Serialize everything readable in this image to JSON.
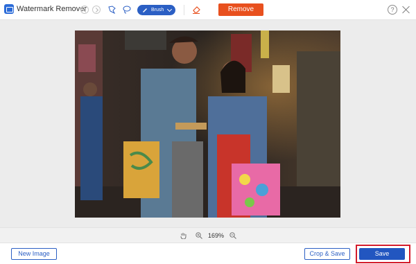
{
  "app": {
    "title": "Watermark Remover"
  },
  "toolbar": {
    "icons": [
      "undo-icon",
      "redo-icon",
      "polygon-lasso-icon",
      "lasso-icon",
      "brush-icon",
      "eraser-icon"
    ],
    "brush_label": "Brush",
    "remove_label": "Remove",
    "help_label": "?"
  },
  "zoom": {
    "level": "169%"
  },
  "footer": {
    "new_image_label": "New Image",
    "crop_save_label": "Crop & Save",
    "save_label": "Save"
  },
  "colors": {
    "accent": "#2b5fc4",
    "remove": "#e8501e",
    "highlight": "#d41b2b"
  }
}
